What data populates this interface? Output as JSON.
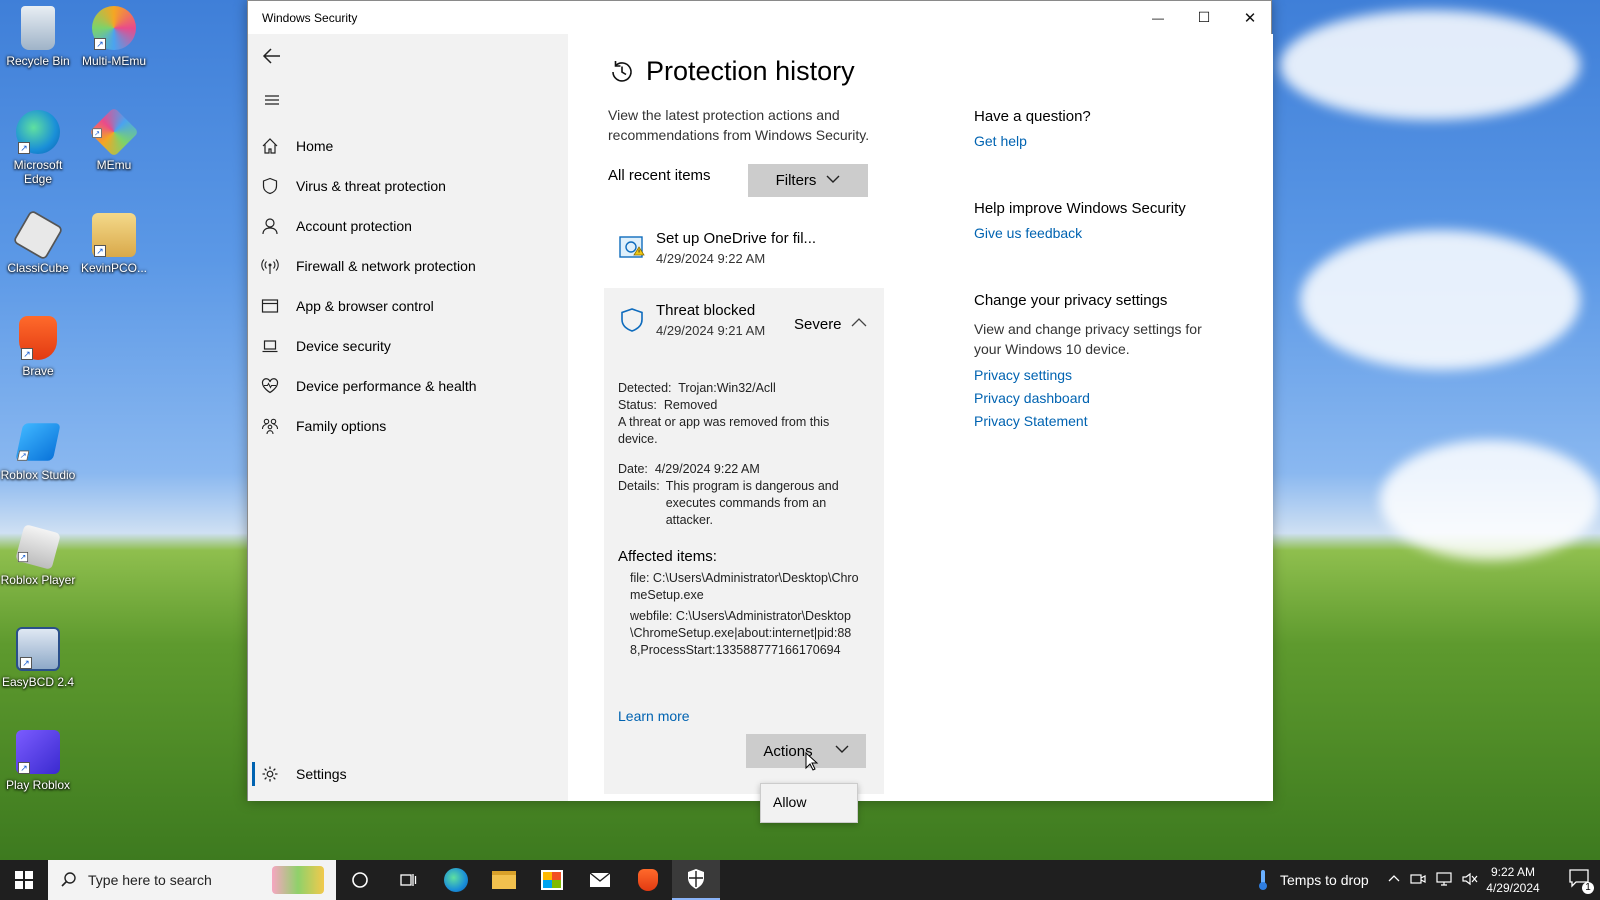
{
  "desktop": {
    "icons": [
      {
        "label": "Recycle Bin"
      },
      {
        "label": "Multi-MEmu"
      },
      {
        "label": "Microsoft Edge"
      },
      {
        "label": "MEmu"
      },
      {
        "label": "ClassiCube"
      },
      {
        "label": "KevinPCO..."
      },
      {
        "label": "Brave"
      },
      {
        "label": "Roblox Studio"
      },
      {
        "label": "Roblox Player"
      },
      {
        "label": "EasyBCD 2.4"
      },
      {
        "label": "Play Roblox"
      }
    ]
  },
  "window": {
    "title": "Windows Security",
    "minimize_glyph": "—",
    "maximize_glyph": "☐",
    "close_glyph": "✕"
  },
  "sidebar": {
    "items": [
      {
        "label": "Home",
        "icon": "home-icon"
      },
      {
        "label": "Virus & threat protection",
        "icon": "shield-icon"
      },
      {
        "label": "Account protection",
        "icon": "person-icon"
      },
      {
        "label": "Firewall & network protection",
        "icon": "antenna-icon"
      },
      {
        "label": "App & browser control",
        "icon": "browser-window-icon"
      },
      {
        "label": "Device security",
        "icon": "laptop-icon"
      },
      {
        "label": "Device performance & health",
        "icon": "heart-icon"
      },
      {
        "label": "Family options",
        "icon": "family-icon"
      }
    ],
    "settings_label": "Settings"
  },
  "main": {
    "title": "Protection history",
    "description": "View the latest protection actions and recommendations from Windows Security.",
    "recent_label": "All recent items",
    "filters_label": "Filters",
    "items": [
      {
        "title": "Set up OneDrive for fil...",
        "date": "4/29/2024 9:22 AM"
      },
      {
        "title": "Threat blocked",
        "date": "4/29/2024 9:21 AM",
        "severity": "Severe",
        "detected_key": "Detected:",
        "detected_val": "Trojan:Win32/Acll",
        "status_key": "Status:",
        "status_val": "Removed",
        "status_note": "A threat or app was removed from this device.",
        "date_key": "Date:",
        "date_val": "4/29/2024 9:22 AM",
        "details_key": "Details:",
        "details_val": "This program is dangerous and executes commands from an attacker.",
        "affected_heading": "Affected items:",
        "affected_file": "file: C:\\Users\\Administrator\\Desktop\\ChromeSetup.exe",
        "affected_webfile": "webfile: C:\\Users\\Administrator\\Desktop\\ChromeSetup.exe|about:internet|pid:888,ProcessStart:133588777166170694",
        "learn_more": "Learn more",
        "actions_label": "Actions",
        "actions_menu": [
          "Allow"
        ]
      }
    ]
  },
  "right_panel": {
    "question_heading": "Have a question?",
    "get_help": "Get help",
    "improve_heading": "Help improve Windows Security",
    "feedback": "Give us feedback",
    "privacy_heading": "Change your privacy settings",
    "privacy_text": "View and change privacy settings for your Windows 10 device.",
    "privacy_links": [
      "Privacy settings",
      "Privacy dashboard",
      "Privacy Statement"
    ]
  },
  "taskbar": {
    "search_placeholder": "Type here to search",
    "weather_text": "Temps to drop",
    "time": "9:22 AM",
    "date": "4/29/2024",
    "notification_count": "1"
  },
  "colors": {
    "accent": "#0063b1",
    "sidebar_bg": "#f2f2f2",
    "button_bg": "#cccccc",
    "taskbar_bg": "#1f1f1f"
  }
}
